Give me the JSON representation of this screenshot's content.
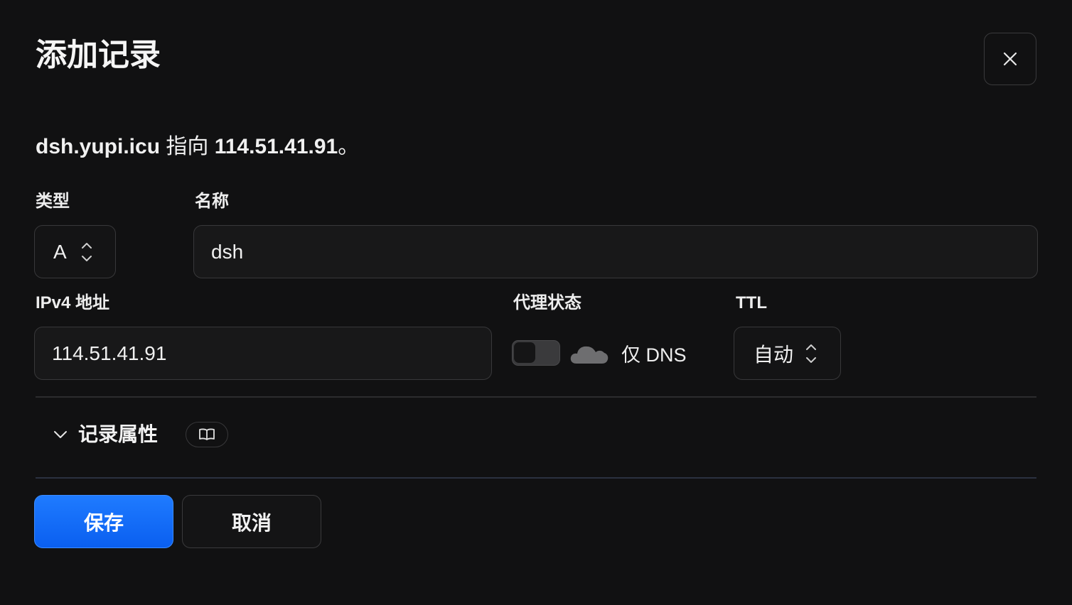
{
  "dialog": {
    "title": "添加记录",
    "close_icon": "close-icon"
  },
  "summary": {
    "name": "dsh.yupi.icu",
    "verb": " 指向 ",
    "target": "114.51.41.91",
    "suffix": "。"
  },
  "form": {
    "type_label": "类型",
    "type_value": "A",
    "name_label": "名称",
    "name_value": "dsh",
    "ipv4_label": "IPv4 地址",
    "ipv4_value": "114.51.41.91",
    "proxy_label": "代理状态",
    "proxy_text": "仅 DNS",
    "proxy_on": false,
    "ttl_label": "TTL",
    "ttl_value": "自动"
  },
  "section": {
    "title": "记录属性",
    "expand_icon": "chevron-down-icon",
    "doc_icon": "book-icon"
  },
  "buttons": {
    "save": "保存",
    "cancel": "取消"
  },
  "colors": {
    "background": "#111112",
    "primary": "#1f7bff",
    "border": "#38383a"
  }
}
